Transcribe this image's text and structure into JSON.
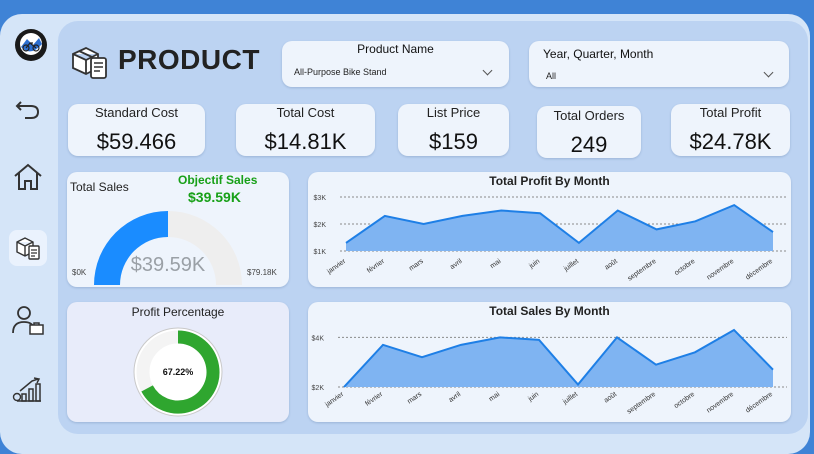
{
  "header": {
    "title": "PRODUCT"
  },
  "slicers": [
    {
      "title": "Product Name",
      "value": "All-Purpose Bike Stand"
    },
    {
      "title": "Year, Quarter, Month",
      "value": "All"
    }
  ],
  "kpis": [
    {
      "label": "Standard Cost",
      "value": "$59.466"
    },
    {
      "label": "Total Cost",
      "value": "$14.81K"
    },
    {
      "label": "List Price",
      "value": "$159"
    },
    {
      "label": "Total Orders",
      "value": "249"
    },
    {
      "label": "Total Profit",
      "value": "$24.78K"
    }
  ],
  "sidebar": {
    "icons": [
      "bike-logo-icon",
      "back-arrow-icon",
      "home-icon",
      "product-box-icon",
      "customer-icon",
      "growth-chart-icon"
    ]
  },
  "colors": {
    "area_fill": "#7fb4f2",
    "line": "#1e7fe6",
    "gauge": "#1a8cff",
    "gauge_bg": "#eeeeee",
    "donut": "#2fa62f",
    "objective": "#18a018"
  },
  "chart_data": [
    {
      "type": "gauge",
      "title": "Total Sales",
      "value": 39.59,
      "min": 0,
      "max": 79.18,
      "value_label": "$39.59K",
      "min_label": "$0K",
      "max_label": "$79.18K",
      "target_title": "Objectif Sales",
      "target_label": "$39.59K"
    },
    {
      "type": "area",
      "title": "Total Profit By Month",
      "categories": [
        "janvier",
        "février",
        "mars",
        "avril",
        "mai",
        "juin",
        "juillet",
        "août",
        "septembre",
        "octobre",
        "novembre",
        "décembre"
      ],
      "values": [
        1300,
        2300,
        2000,
        2300,
        2500,
        2400,
        1300,
        2500,
        1800,
        2100,
        2700,
        1700
      ],
      "ylim": [
        1000,
        3000
      ],
      "yticks": [
        1000,
        2000,
        3000
      ],
      "ytick_labels": [
        "$1K",
        "$2K",
        "$3K"
      ],
      "grid": true
    },
    {
      "type": "donut",
      "title": "Profit Percentage",
      "value": 67.22,
      "value_label": "67.22%"
    },
    {
      "type": "area",
      "title": "Total Sales By Month",
      "categories": [
        "janvier",
        "février",
        "mars",
        "avril",
        "mai",
        "juin",
        "juillet",
        "août",
        "septembre",
        "octobre",
        "novembre",
        "décembre"
      ],
      "values": [
        2000,
        3700,
        3200,
        3700,
        4000,
        3900,
        2100,
        4000,
        2900,
        3400,
        4300,
        2700
      ],
      "ylim": [
        2000,
        4500
      ],
      "yticks": [
        2000,
        4000
      ],
      "ytick_labels": [
        "$2K",
        "$4K"
      ],
      "grid": true
    }
  ]
}
